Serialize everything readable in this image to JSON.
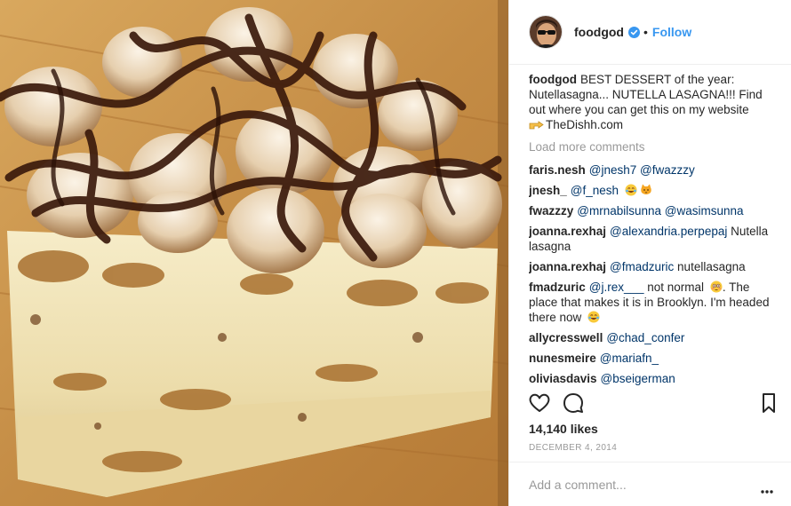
{
  "header": {
    "username": "foodgod",
    "separator": "•",
    "follow_label": "Follow",
    "verified_icon": "verified-badge-icon",
    "verified_color": "#3897f0"
  },
  "caption": {
    "username": "foodgod",
    "text": "BEST DESSERT of the year: Nutellasagna... NUTELLA LASAGNA!!! Find out where you can get this on my website",
    "emoji_icon": "pointing-right-emoji",
    "link": "TheDishh.com"
  },
  "load_more": "Load more comments",
  "comments": [
    {
      "user": "faris.nesh",
      "mentions": "@jnesh7 @fwazzzy",
      "text": ""
    },
    {
      "user": "jnesh_",
      "mentions": "@f_nesh",
      "text": "",
      "emojis": [
        "crying-laughing-emoji",
        "cat-emoji"
      ]
    },
    {
      "user": "fwazzzy",
      "mentions": "@mrnabilsunna @wasimsunna",
      "text": ""
    },
    {
      "user": "joanna.rexhaj",
      "mentions": "@alexandria.perpepaj",
      "text": "Nutella lasagna"
    },
    {
      "user": "joanna.rexhaj",
      "mentions": "@fmadzuric",
      "text": "nutellasagna"
    },
    {
      "user": "fmadzuric",
      "mentions": "@j.rex___",
      "text": "not normal",
      "text2": ". The place that makes it is in Brooklyn. I'm headed there now",
      "emojis": [
        "flushed-emoji",
        "crying-laughing-emoji"
      ]
    },
    {
      "user": "allycresswell",
      "mentions": "@chad_confer",
      "text": ""
    },
    {
      "user": "nunesmeire",
      "mentions": "@mariafn_",
      "text": ""
    },
    {
      "user": "oliviasdavis",
      "mentions": "@bseigerman",
      "text": ""
    }
  ],
  "actions": {
    "like_icon": "heart-icon",
    "comment_icon": "comment-bubble-icon",
    "save_icon": "bookmark-icon"
  },
  "likes": "14,140 likes",
  "date": "DECEMBER 4, 2014",
  "add_comment": {
    "placeholder": "Add a comment...",
    "more_icon": "more-options-icon"
  },
  "colors": {
    "link_blue": "#3897f0",
    "mention_blue": "#003569",
    "muted_gray": "#999999",
    "text_dark": "#262626",
    "divider": "#efefef"
  },
  "photo": {
    "subject": "Nutella lasagna dessert with toasted marshmallows and chocolate drizzle on a wooden board"
  }
}
